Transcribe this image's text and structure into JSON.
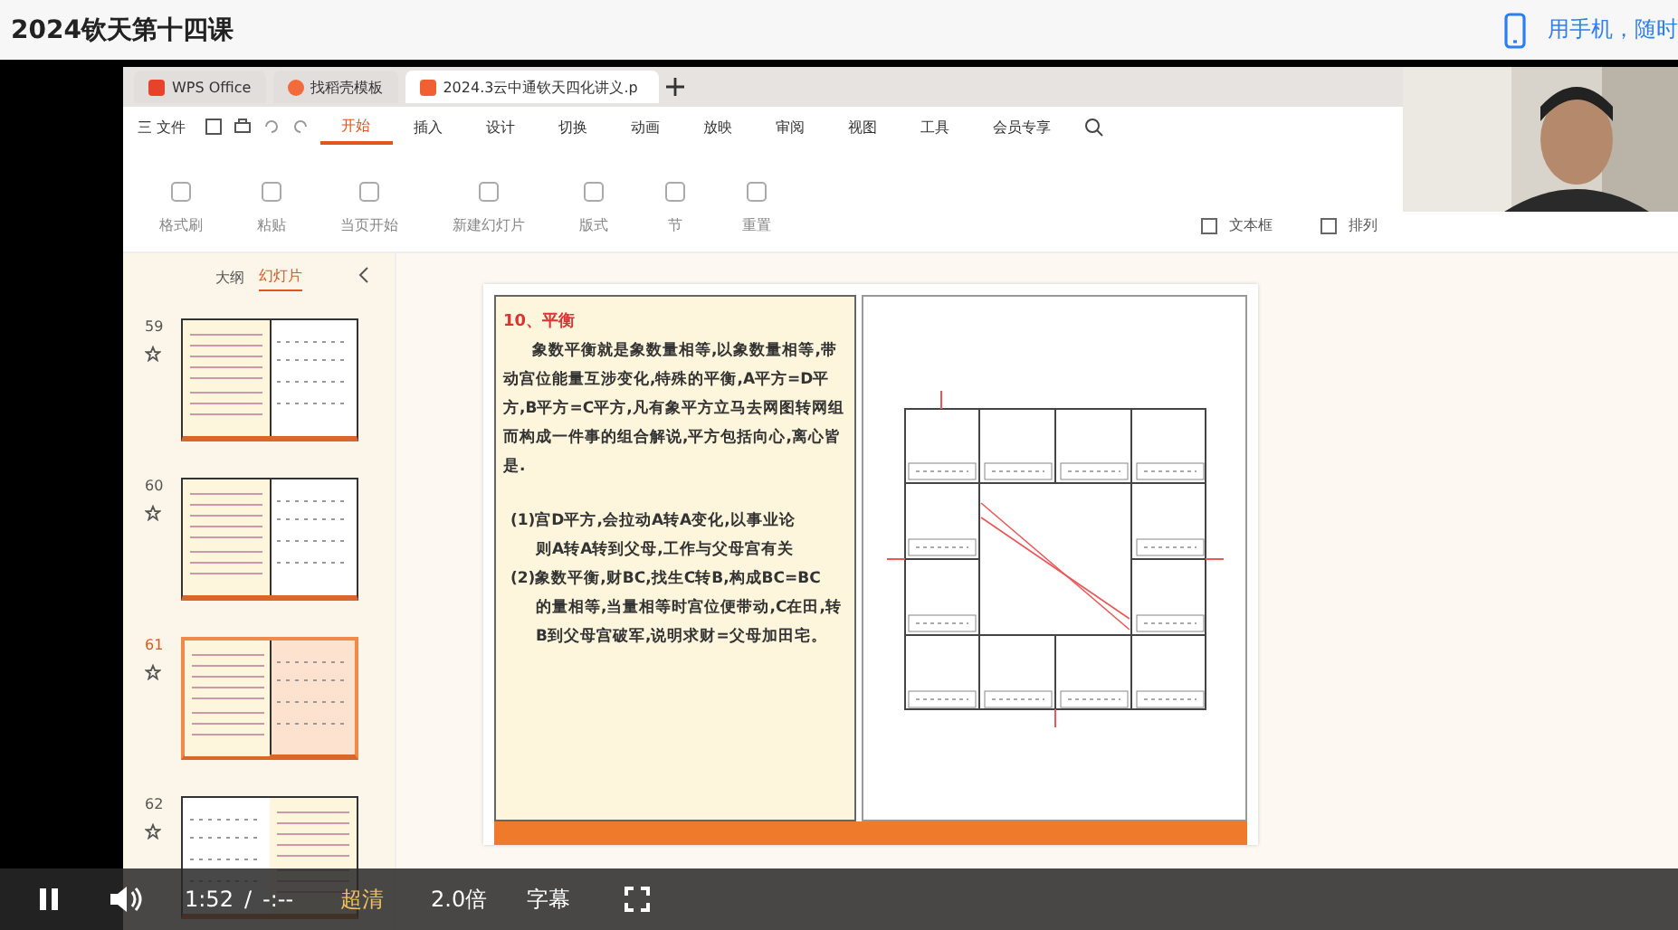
{
  "page_title": "2024钦天第十四课",
  "phone_link": "用手机，随时",
  "wps": {
    "tabs": [
      {
        "label": "WPS Office",
        "kind": "home",
        "selected": false
      },
      {
        "label": "找稻壳模板",
        "kind": "template",
        "selected": false
      },
      {
        "label": "2024.3云中通钦天四化讲义.p",
        "kind": "doc",
        "selected": true
      }
    ],
    "file_menu": "三 文件",
    "menu": [
      {
        "label": "开始",
        "selected": true
      },
      {
        "label": "插入",
        "selected": false
      },
      {
        "label": "设计",
        "selected": false
      },
      {
        "label": "切换",
        "selected": false
      },
      {
        "label": "动画",
        "selected": false
      },
      {
        "label": "放映",
        "selected": false
      },
      {
        "label": "审阅",
        "selected": false
      },
      {
        "label": "视图",
        "selected": false
      },
      {
        "label": "工具",
        "selected": false
      },
      {
        "label": "会员专享",
        "selected": false
      }
    ],
    "ribbon": [
      {
        "label": "格式刷"
      },
      {
        "label": "粘贴"
      },
      {
        "label": "当页开始"
      },
      {
        "label": "新建幻灯片"
      },
      {
        "label": "版式"
      },
      {
        "label": "节"
      },
      {
        "label": "重置"
      }
    ],
    "ribbon_right": [
      {
        "label": "文本框"
      },
      {
        "label": "排列"
      }
    ],
    "panel_tabs": [
      {
        "label": "大纲",
        "selected": false
      },
      {
        "label": "幻灯片",
        "selected": true
      }
    ],
    "thumbnails": [
      {
        "number": "59",
        "kind": "text-left",
        "selected": false
      },
      {
        "number": "60",
        "kind": "text-left",
        "selected": false
      },
      {
        "number": "61",
        "kind": "text-left",
        "selected": true
      },
      {
        "number": "62",
        "kind": "chart-left",
        "selected": false
      }
    ],
    "slide": {
      "title": "10、平衡",
      "paragraph": "象数平衡就是象数量相等,以象数量相等,带动宫位能量互涉变化,特殊的平衡,A平方=D平方,B平方=C平方,凡有象平方立马去网图转网组而构成一件事的组合解说,平方包括向心,离心皆是.",
      "points": [
        {
          "lead": "(1)宫D平方,会拉动A转A变化,以事业论",
          "rest": "则A转A转到父母,工作与父母宫有关"
        },
        {
          "lead": "(2)象数平衡,财BC,找生C转B,构成BC=BC",
          "rest": "的量相等,当量相等时宫位便带动,C在田,转B到父母宫破军,说明求财=父母加田宅。"
        }
      ]
    }
  },
  "player": {
    "playing": true,
    "time": "1:52",
    "separator": "/",
    "duration": "-:--",
    "quality": "超清",
    "speed": "2.0倍",
    "subtitles": "字幕"
  }
}
